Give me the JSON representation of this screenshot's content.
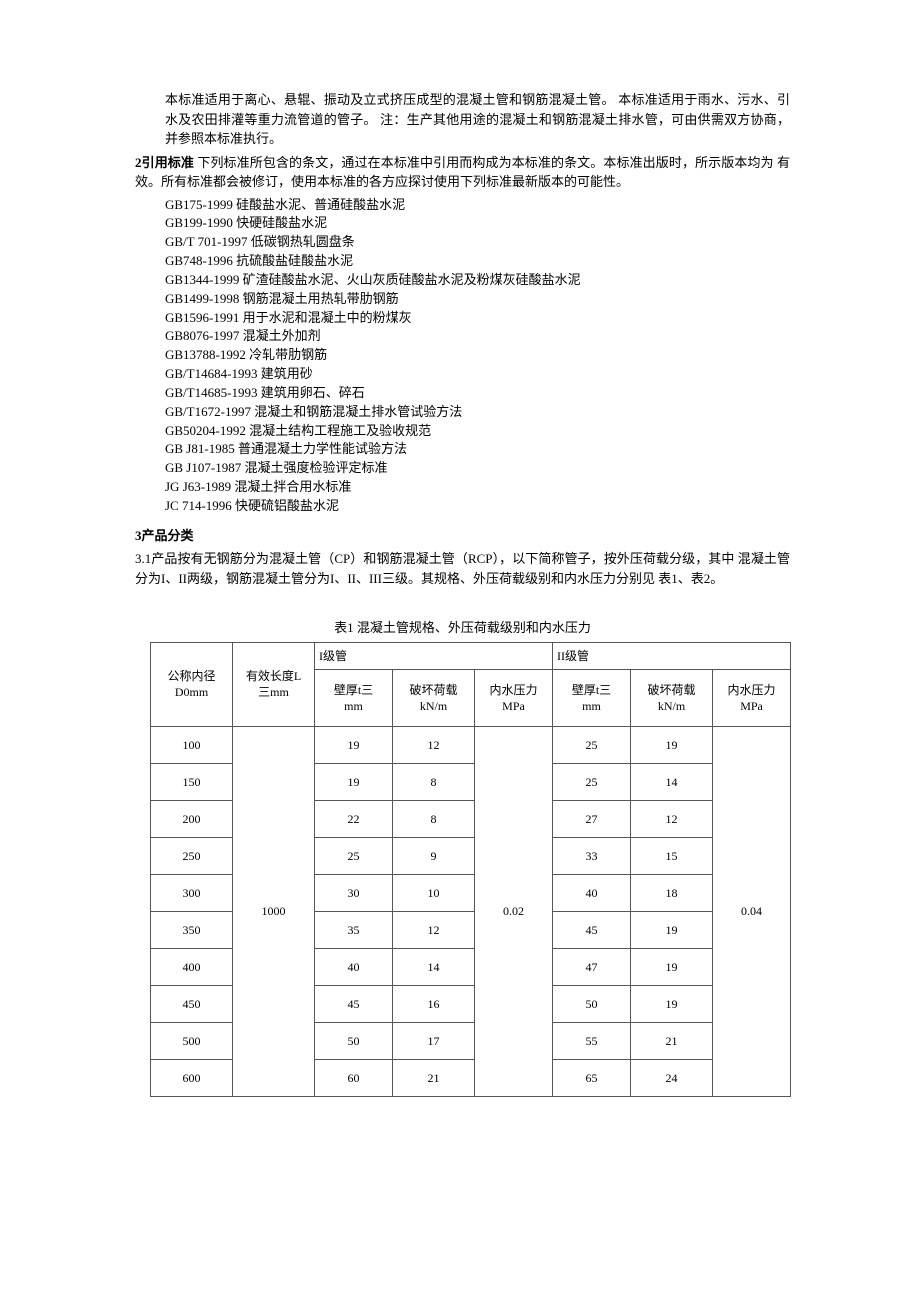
{
  "intro_para": "本标准适用于离心、悬辊、振动及立式挤压成型的混凝土管和钢筋混凝土管。 本标准适用于雨水、污水、引水及农田排灌等重力流管道的管子。 注：生产其他用途的混凝土和钢筋混凝土排水管，可由供需双方协商，并参照本标准执行。",
  "section2": {
    "title": "2引用标准",
    "text": "下列标准所包含的条文，通过在本标准中引用而构成为本标准的条文。本标准出版时，所示版本均为 有效。所有标准都会被修订，使用本标准的各方应探讨使用下列标准最新版本的可能性。"
  },
  "standards": [
    "GB175-1999 硅酸盐水泥、普通硅酸盐水泥",
    "GB199-1990 快硬硅酸盐水泥",
    "GB/T 701-1997 低碳钢热轧圆盘条",
    "GB748-1996 抗硫酸盐硅酸盐水泥",
    "GB1344-1999 矿渣硅酸盐水泥、火山灰质硅酸盐水泥及粉煤灰硅酸盐水泥",
    "GB1499-1998 钢筋混凝土用热轧带肋钢筋",
    "GB1596-1991 用于水泥和混凝土中的粉煤灰",
    "GB8076-1997 混凝土外加剂",
    "GB13788-1992 冷轧带肋钢筋",
    "GB/T14684-1993 建筑用砂",
    "GB/T14685-1993 建筑用卵石、碎石",
    "GB/T1672-1997 混凝土和钢筋混凝土排水管试验方法",
    "GB50204-1992 混凝土结构工程施工及验收规范",
    "GB J81-1985 普通混凝土力学性能试验方法",
    "GB J107-1987 混凝土强度检验评定标准",
    "JG J63-1989 混凝土拌合用水标准",
    "JC 714-1996 快硬硫铝酸盐水泥"
  ],
  "section3": {
    "title": "3产品分类",
    "text": "3.1产品按有无钢筋分为混凝土管（CP）和钢筋混凝土管（RCP），以下简称管子，按外压荷载分级，其中 混凝土管分为I、II两级，钢筋混凝土管分为I、II、III三级。其规格、外压荷载级别和内水压力分别见 表1、表2。"
  },
  "table": {
    "caption": "表1 混凝土管规格、外压荷载级别和内水压力",
    "head": {
      "col0_l1": "公称内径",
      "col0_l2": "D0mm",
      "col1_l1": "有效长度L",
      "col1_l2": "三mm",
      "group1": "I级管",
      "group2": "II级管",
      "wall_l1": "壁厚t三",
      "wall_l2": "mm",
      "load_l1": "破坏荷载",
      "load_l2": "kN/m",
      "press_l1": "内水压力",
      "press_l2": "MPa"
    },
    "length_value": "1000",
    "pressure1": "0.02",
    "pressure2": "0.04",
    "rows": [
      {
        "d": "100",
        "t1": "19",
        "f1": "12",
        "t2": "25",
        "f2": "19"
      },
      {
        "d": "150",
        "t1": "19",
        "f1": "8",
        "t2": "25",
        "f2": "14"
      },
      {
        "d": "200",
        "t1": "22",
        "f1": "8",
        "t2": "27",
        "f2": "12"
      },
      {
        "d": "250",
        "t1": "25",
        "f1": "9",
        "t2": "33",
        "f2": "15"
      },
      {
        "d": "300",
        "t1": "30",
        "f1": "10",
        "t2": "40",
        "f2": "18"
      },
      {
        "d": "350",
        "t1": "35",
        "f1": "12",
        "t2": "45",
        "f2": "19"
      },
      {
        "d": "400",
        "t1": "40",
        "f1": "14",
        "t2": "47",
        "f2": "19"
      },
      {
        "d": "450",
        "t1": "45",
        "f1": "16",
        "t2": "50",
        "f2": "19"
      },
      {
        "d": "500",
        "t1": "50",
        "f1": "17",
        "t2": "55",
        "f2": "21"
      },
      {
        "d": "600",
        "t1": "60",
        "f1": "21",
        "t2": "65",
        "f2": "24"
      }
    ]
  }
}
